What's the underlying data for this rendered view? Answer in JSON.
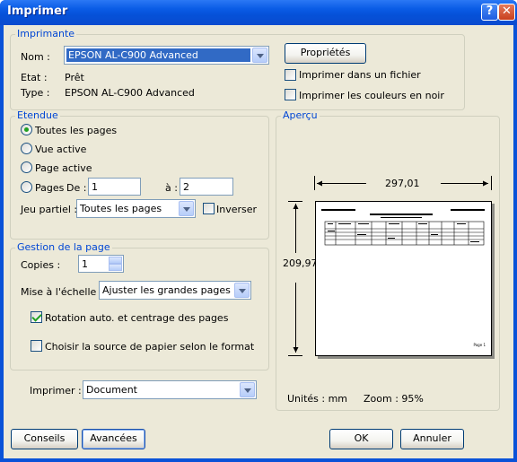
{
  "window": {
    "title": "Imprimer",
    "help_glyph": "?",
    "close_glyph": "✕"
  },
  "printer": {
    "group_label": "Imprimante",
    "name_label": "Nom :",
    "name_value": "EPSON AL-C900 Advanced",
    "status_label": "Etat :",
    "status_value": "Prêt",
    "type_label": "Type :",
    "type_value": "EPSON AL-C900 Advanced",
    "properties_button": "Propriétés",
    "print_to_file": {
      "label": "Imprimer dans un fichier",
      "checked": false
    },
    "print_black": {
      "label": "Imprimer les couleurs en noir",
      "checked": false
    }
  },
  "range": {
    "group_label": "Etendue",
    "all_pages": "Toutes les pages",
    "active_view": "Vue active",
    "active_page": "Page active",
    "pages_label": "Pages",
    "from_label": "De :",
    "from_value": "1",
    "to_label": "à :",
    "to_value": "2",
    "selected": "all_pages",
    "subset_label": "Jeu partiel :",
    "subset_value": "Toutes les pages",
    "reverse": {
      "label": "Inverser",
      "checked": false
    }
  },
  "page_setup": {
    "group_label": "Gestion de la page",
    "copies_label": "Copies :",
    "copies_value": "1",
    "scale_label": "Mise à l'échelle :",
    "scale_value": "Ajuster les grandes pages",
    "auto_rotate": {
      "label": "Rotation auto. et centrage des pages",
      "checked": true
    },
    "paper_source": {
      "label": "Choisir la source de papier selon le format",
      "checked": false
    }
  },
  "print_what": {
    "label": "Imprimer :",
    "value": "Document"
  },
  "preview": {
    "group_label": "Aperçu",
    "width_value": "297,01",
    "height_value": "209,97",
    "units": "Unités : mm",
    "zoom": "Zoom :  95%",
    "page_footer": "Page 1"
  },
  "footer": {
    "tips_button": "Conseils",
    "advanced_button": "Avancées",
    "ok_button": "OK",
    "cancel_button": "Annuler"
  },
  "colors": {
    "title_bar": "#0a5ce6",
    "dialog_bg": "#ece9d8",
    "group_label": "#0046d5",
    "selection": "#316ac5"
  }
}
